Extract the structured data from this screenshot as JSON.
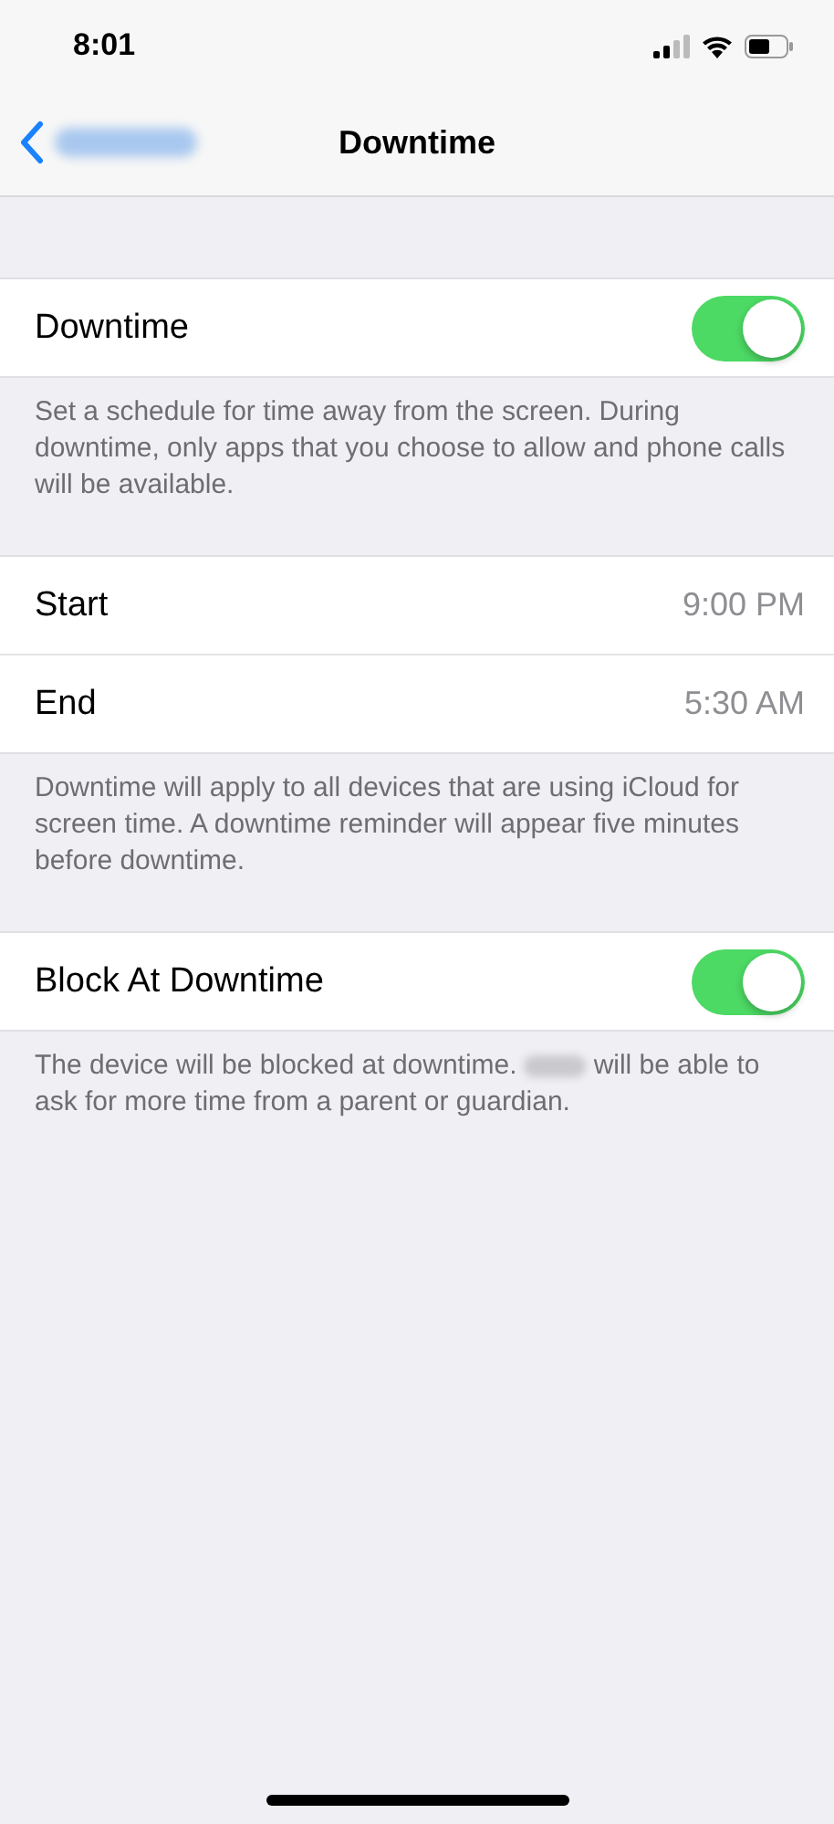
{
  "status_bar": {
    "time": "8:01"
  },
  "nav": {
    "title": "Downtime"
  },
  "sections": [
    {
      "rows": [
        {
          "kind": "toggle",
          "label": "Downtime",
          "on": true
        }
      ],
      "footer": "Set a schedule for time away from the screen. During downtime, only apps that you choose to allow and phone calls will be available."
    },
    {
      "rows": [
        {
          "kind": "value",
          "label": "Start",
          "value": "9:00 PM"
        },
        {
          "kind": "value",
          "label": "End",
          "value": "5:30 AM"
        }
      ],
      "footer": "Downtime will apply to all devices that are using iCloud for screen time. A downtime reminder will appear five minutes before downtime."
    },
    {
      "rows": [
        {
          "kind": "toggle",
          "label": "Block At Downtime",
          "on": true
        }
      ],
      "footer": "The device will be blocked at downtime.",
      "footer_after_redaction": "will be able to ask for more time from a parent or guardian."
    }
  ]
}
